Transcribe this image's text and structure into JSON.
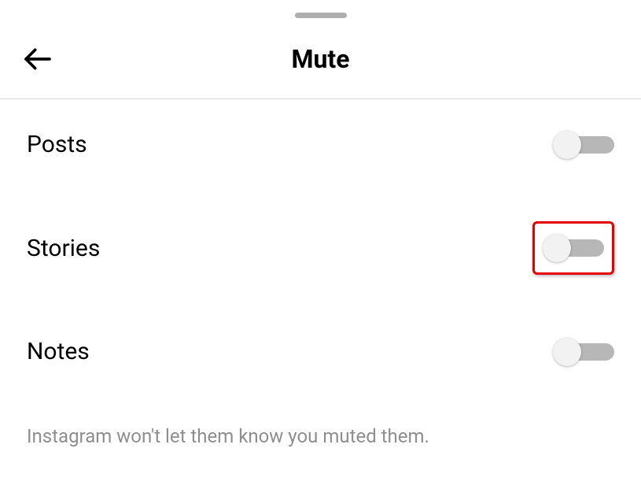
{
  "header": {
    "title": "Mute"
  },
  "settings": {
    "posts": {
      "label": "Posts",
      "enabled": false
    },
    "stories": {
      "label": "Stories",
      "enabled": false,
      "highlighted": true
    },
    "notes": {
      "label": "Notes",
      "enabled": false
    }
  },
  "footer": {
    "note": "Instagram won't let them know you muted them."
  }
}
